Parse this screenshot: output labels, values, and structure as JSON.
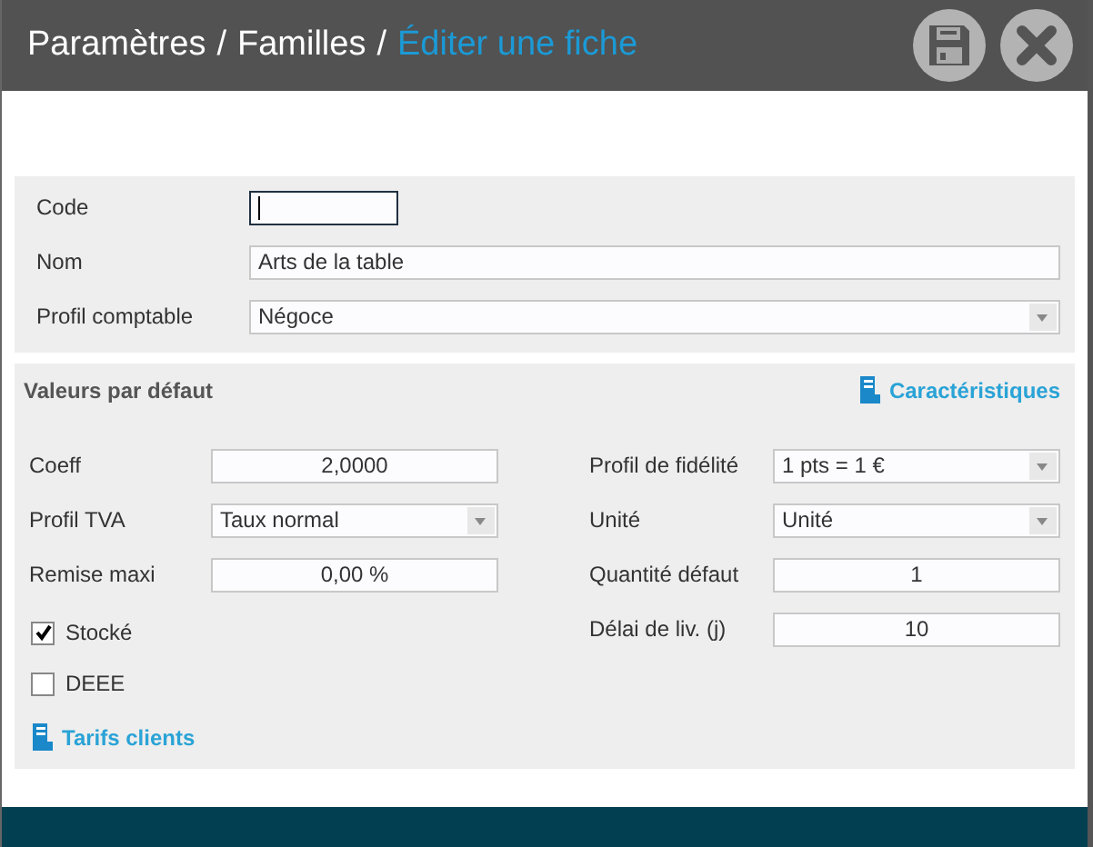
{
  "breadcrumb": {
    "separator": "/",
    "items": [
      {
        "label": "Paramètres",
        "current": false
      },
      {
        "label": "Familles",
        "current": false
      },
      {
        "label": "Éditer une fiche",
        "current": true
      }
    ]
  },
  "main_fields": [
    {
      "label": "Code",
      "kind": "code",
      "focused": true
    },
    {
      "label": "Nom",
      "kind": "text",
      "value": "Arts de la table",
      "focused": false
    },
    {
      "label": "Profil comptable",
      "kind": "select",
      "value": "Négoce"
    }
  ],
  "defaults": {
    "title": "Valeurs par défaut",
    "link": "Caractéristiques",
    "left_fields": [
      {
        "label": "Coeff",
        "kind": "number",
        "value": "2,0000"
      },
      {
        "label": "Profil TVA",
        "kind": "select",
        "value": "Taux normal"
      },
      {
        "label": "Remise maxi",
        "kind": "number",
        "value": "0,00 %"
      }
    ],
    "checkboxes": [
      {
        "label": "Stocké",
        "checked": true
      },
      {
        "label": "DEEE",
        "checked": false
      }
    ],
    "bottom_link": "Tarifs clients",
    "right_fields": [
      {
        "label": "Profil de fidélité",
        "kind": "select",
        "value": "1 pts = 1 €"
      },
      {
        "label": "Unité",
        "kind": "select",
        "value": "Unité"
      },
      {
        "label": "Quantité défaut",
        "kind": "number",
        "value": "1"
      },
      {
        "label": "Délai de liv. (j)",
        "kind": "number",
        "value": "10"
      }
    ]
  }
}
